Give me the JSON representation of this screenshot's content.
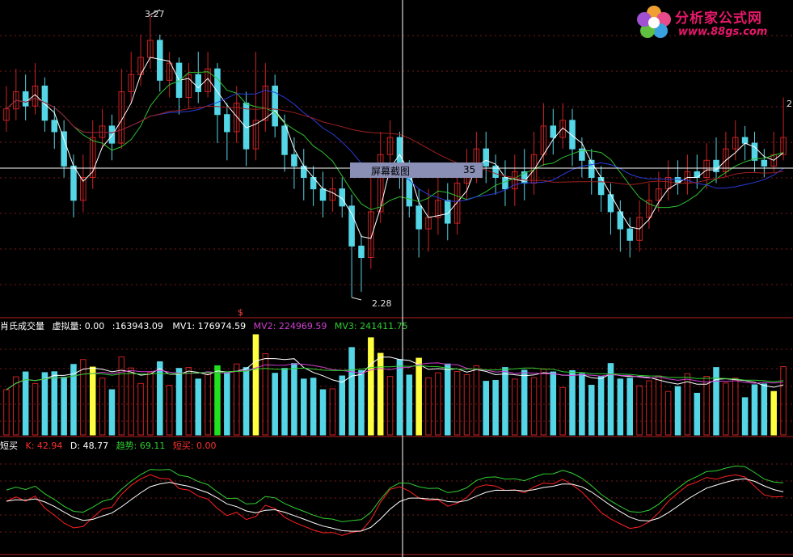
{
  "colors": {
    "background": "#000000",
    "up": "#cc2222",
    "down": "#55d6e6",
    "ma_white": "#ffffff",
    "ma_blue": "#2a3cd8",
    "ma_green": "#2fbf2f",
    "ma_darkred": "#a02020",
    "mv1": "#ffffff",
    "mv2": "#d040d0",
    "mv3": "#30d030",
    "k_line": "#ff2020",
    "d_line": "#ffffff",
    "trend_line": "#30d030",
    "highlight_yellow": "#ffff40",
    "highlight_green": "#20e020",
    "logo": "#e8186a"
  },
  "price_panel": {
    "high_label": "3.27",
    "low_label": "2.28",
    "right_label": "2",
    "marker": "$"
  },
  "popup": {
    "text": "屏幕截图",
    "number": "35"
  },
  "volume_panel": {
    "title": "肖氏成交量",
    "virtual_label": "虚拟量",
    "virtual_value": "0.00",
    "total_value": ":163943.09",
    "mv1_label": "MV1:",
    "mv1_value": "176974.59",
    "mv2_label": "MV2:",
    "mv2_value": "224969.59",
    "mv3_label": "MV3:",
    "mv3_value": "241411.75"
  },
  "indicator_panel": {
    "title": "短买",
    "k_label": "K:",
    "k_value": "42.94",
    "d_label": "D:",
    "d_value": "48.77",
    "trend_label": "趋势:",
    "trend_value": "69.11",
    "short_label": "短买:",
    "short_value": "0.00"
  },
  "logo": {
    "name": "分析家公式网",
    "url": "www.88gs.com"
  },
  "chart_data": {
    "type": "candlestick",
    "title": "",
    "price_range": [
      2.28,
      3.27
    ],
    "candles": [
      [
        2.9,
        2.94,
        3.02,
        2.86
      ],
      [
        2.94,
        3.0,
        3.08,
        2.9
      ],
      [
        3.0,
        2.95,
        3.06,
        2.9
      ],
      [
        2.95,
        3.02,
        3.1,
        2.92
      ],
      [
        3.02,
        2.9,
        3.05,
        2.86
      ],
      [
        2.9,
        2.86,
        2.95,
        2.8
      ],
      [
        2.86,
        2.74,
        2.9,
        2.7
      ],
      [
        2.74,
        2.62,
        2.78,
        2.56
      ],
      [
        2.62,
        2.7,
        2.78,
        2.58
      ],
      [
        2.7,
        2.84,
        2.9,
        2.66
      ],
      [
        2.84,
        2.88,
        2.94,
        2.8
      ],
      [
        2.88,
        2.82,
        2.92,
        2.76
      ],
      [
        2.82,
        3.0,
        3.08,
        2.8
      ],
      [
        3.0,
        3.06,
        3.14,
        2.96
      ],
      [
        3.06,
        3.12,
        3.2,
        3.02
      ],
      [
        3.12,
        3.18,
        3.27,
        3.08
      ],
      [
        3.18,
        3.04,
        3.2,
        3.0
      ],
      [
        3.04,
        3.1,
        3.14,
        2.98
      ],
      [
        3.1,
        2.98,
        3.12,
        2.92
      ],
      [
        2.98,
        3.06,
        3.1,
        2.94
      ],
      [
        3.06,
        3.0,
        3.14,
        2.96
      ],
      [
        3.0,
        3.08,
        3.14,
        2.98
      ],
      [
        3.08,
        2.92,
        3.1,
        2.82
      ],
      [
        2.92,
        2.86,
        2.96,
        2.76
      ],
      [
        2.86,
        2.96,
        3.02,
        2.82
      ],
      [
        2.96,
        2.8,
        3.0,
        2.74
      ],
      [
        2.8,
        2.9,
        3.14,
        2.76
      ],
      [
        2.9,
        3.02,
        3.1,
        2.86
      ],
      [
        3.02,
        2.88,
        3.06,
        2.84
      ],
      [
        2.88,
        2.78,
        2.92,
        2.72
      ],
      [
        2.78,
        2.74,
        2.84,
        2.66
      ],
      [
        2.74,
        2.7,
        2.8,
        2.62
      ],
      [
        2.7,
        2.66,
        2.74,
        2.6
      ],
      [
        2.66,
        2.62,
        2.72,
        2.56
      ],
      [
        2.62,
        2.66,
        2.7,
        2.58
      ],
      [
        2.66,
        2.6,
        2.7,
        2.56
      ],
      [
        2.6,
        2.46,
        2.64,
        2.28
      ],
      [
        2.46,
        2.42,
        2.5,
        2.3
      ],
      [
        2.42,
        2.58,
        2.7,
        2.38
      ],
      [
        2.58,
        2.78,
        2.86,
        2.54
      ],
      [
        2.78,
        2.84,
        2.9,
        2.74
      ],
      [
        2.84,
        2.72,
        2.86,
        2.66
      ],
      [
        2.72,
        2.6,
        2.76,
        2.56
      ],
      [
        2.6,
        2.52,
        2.66,
        2.42
      ],
      [
        2.52,
        2.56,
        2.66,
        2.44
      ],
      [
        2.56,
        2.62,
        2.7,
        2.5
      ],
      [
        2.62,
        2.54,
        2.68,
        2.48
      ],
      [
        2.54,
        2.68,
        2.74,
        2.5
      ],
      [
        2.68,
        2.74,
        2.8,
        2.62
      ],
      [
        2.74,
        2.8,
        2.86,
        2.68
      ],
      [
        2.8,
        2.74,
        2.86,
        2.68
      ],
      [
        2.74,
        2.7,
        2.78,
        2.64
      ],
      [
        2.7,
        2.66,
        2.76,
        2.6
      ],
      [
        2.66,
        2.72,
        2.78,
        2.6
      ],
      [
        2.72,
        2.68,
        2.8,
        2.62
      ],
      [
        2.68,
        2.78,
        2.86,
        2.64
      ],
      [
        2.78,
        2.88,
        2.96,
        2.74
      ],
      [
        2.88,
        2.84,
        2.94,
        2.78
      ],
      [
        2.84,
        2.9,
        2.96,
        2.8
      ],
      [
        2.9,
        2.8,
        2.94,
        2.74
      ],
      [
        2.8,
        2.76,
        2.84,
        2.7
      ],
      [
        2.76,
        2.7,
        2.8,
        2.64
      ],
      [
        2.7,
        2.64,
        2.74,
        2.58
      ],
      [
        2.64,
        2.58,
        2.68,
        2.5
      ],
      [
        2.58,
        2.52,
        2.62,
        2.44
      ],
      [
        2.52,
        2.48,
        2.56,
        2.42
      ],
      [
        2.48,
        2.56,
        2.62,
        2.44
      ],
      [
        2.56,
        2.62,
        2.68,
        2.52
      ],
      [
        2.62,
        2.66,
        2.72,
        2.58
      ],
      [
        2.66,
        2.7,
        2.76,
        2.62
      ],
      [
        2.7,
        2.68,
        2.76,
        2.64
      ],
      [
        2.68,
        2.72,
        2.78,
        2.64
      ],
      [
        2.72,
        2.7,
        2.78,
        2.66
      ],
      [
        2.7,
        2.76,
        2.82,
        2.66
      ],
      [
        2.76,
        2.72,
        2.84,
        2.68
      ],
      [
        2.72,
        2.8,
        2.86,
        2.7
      ],
      [
        2.8,
        2.84,
        2.9,
        2.76
      ],
      [
        2.84,
        2.82,
        2.88,
        2.76
      ],
      [
        2.82,
        2.76,
        2.86,
        2.72
      ],
      [
        2.76,
        2.74,
        2.8,
        2.7
      ],
      [
        2.74,
        2.78,
        2.86,
        2.72
      ],
      [
        2.78,
        2.84,
        2.98,
        2.76
      ]
    ],
    "volume": {
      "mv_periods": [
        "MV1",
        "MV2",
        "MV3"
      ]
    },
    "indicator": {
      "series": [
        "K",
        "D",
        "趋势"
      ],
      "ylim": [
        0,
        100
      ]
    }
  }
}
